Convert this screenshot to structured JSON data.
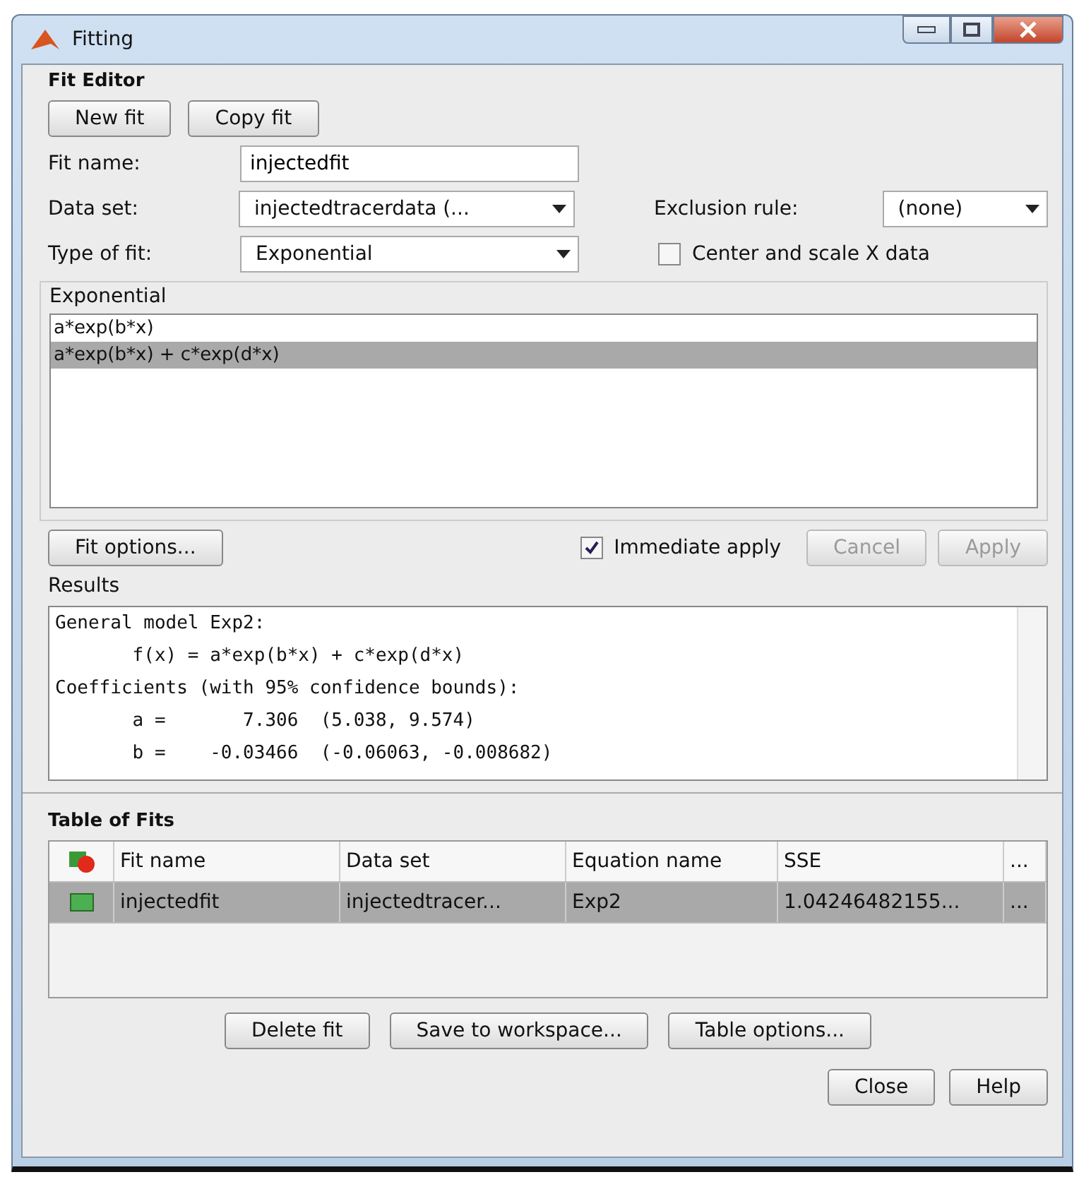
{
  "window": {
    "title": "Fitting"
  },
  "fit_editor": {
    "title": "Fit Editor",
    "buttons": [
      "New fit",
      "Copy fit"
    ],
    "fit_name": {
      "label": "Fit name:",
      "value": "injectedfit"
    },
    "data_set": {
      "label": "Data set:",
      "value": "injectedtracerdata (..."
    },
    "exclusion_rule": {
      "label": "Exclusion rule:",
      "value": "(none)"
    },
    "type_of_fit": {
      "label": "Type of fit:",
      "value": "Exponential"
    },
    "center_scale": {
      "label": "Center and scale X data",
      "checked": false
    },
    "equations": {
      "title": "Exponential",
      "items": [
        {
          "label": "a*exp(b*x)",
          "selected": false
        },
        {
          "label": "a*exp(b*x) + c*exp(d*x)",
          "selected": true
        }
      ]
    },
    "fit_options_button": "Fit options...",
    "immediate_apply": {
      "label": "Immediate apply",
      "checked": true
    },
    "action_buttons": [
      {
        "label": "Cancel",
        "disabled": true
      },
      {
        "label": "Apply",
        "disabled": true
      }
    ],
    "results": {
      "title": "Results",
      "lines": [
        "General model Exp2:",
        "       f(x) = a*exp(b*x) + c*exp(d*x)",
        "Coefficients (with 95% confidence bounds):",
        "       a =       7.306  (5.038, 9.574)",
        "       b =    -0.03466  (-0.06063, -0.008682)"
      ]
    }
  },
  "table_of_fits": {
    "title": "Table of Fits",
    "columns": [
      "Fit name",
      "Data set",
      "Equation name",
      "SSE",
      "..."
    ],
    "rows": [
      {
        "selected": true,
        "cells": [
          "injectedfit",
          "injectedtracer...",
          "Exp2",
          "1.04246482155...",
          "..."
        ]
      }
    ],
    "buttons": [
      "Delete fit",
      "Save to workspace...",
      "Table options..."
    ]
  },
  "footer_buttons": [
    "Close",
    "Help"
  ]
}
